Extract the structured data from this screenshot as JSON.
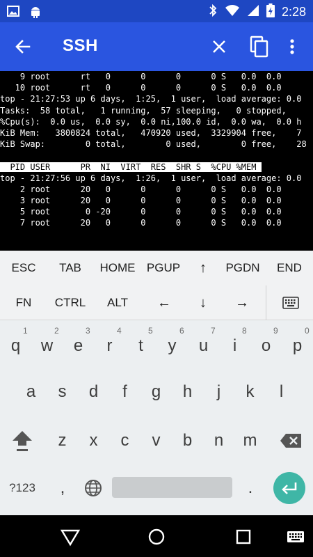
{
  "status_bar": {
    "time": "2:28",
    "icons": [
      "image-icon",
      "android-icon",
      "bluetooth-icon",
      "wifi-icon",
      "signal-icon",
      "battery-charging-icon"
    ]
  },
  "app_bar": {
    "title": "SSH",
    "bg_color": "#2a55e0"
  },
  "terminal": {
    "lines": [
      "    9 root      rt   0      0      0      0 S   0.0  0.0",
      "   10 root      rt   0      0      0      0 S   0.0  0.0",
      "top - 21:27:53 up 6 days,  1:25,  1 user,  load average: 0.0",
      "Tasks:  58 total,   1 running,  57 sleeping,   0 stopped,",
      "%Cpu(s):  0.0 us,  0.0 sy,  0.0 ni,100.0 id,  0.0 wa,  0.0 h",
      "KiB Mem:   3800824 total,   470920 used,  3329904 free,    7",
      "KiB Swap:        0 total,        0 used,        0 free,    28",
      "",
      "  PID USER      PR  NI  VIRT  RES  SHR S  %CPU %MEM ",
      "top - 21:27:56 up 6 days,  1:26,  1 user,  load average: 0.0",
      "    2 root      20   0      0      0      0 S   0.0  0.0",
      "    3 root      20   0      0      0      0 S   0.0  0.0",
      "    5 root       0 -20      0      0      0 S   0.0  0.0",
      "    7 root      20   0      0      0      0 S   0.0  0.0"
    ]
  },
  "extra_keys": {
    "row1": [
      "ESC",
      "TAB",
      "HOME",
      "PGUP",
      "↑",
      "PGDN",
      "END"
    ],
    "row2": [
      "FN",
      "CTRL",
      "ALT",
      "←",
      "↓",
      "→"
    ]
  },
  "keyboard": {
    "row1": [
      "q",
      "w",
      "e",
      "r",
      "t",
      "y",
      "u",
      "i",
      "o",
      "p"
    ],
    "row1_hints": [
      "1",
      "2",
      "3",
      "4",
      "5",
      "6",
      "7",
      "8",
      "9",
      "0"
    ],
    "row2": [
      "a",
      "s",
      "d",
      "f",
      "g",
      "h",
      "j",
      "k",
      "l"
    ],
    "row3": [
      "z",
      "x",
      "c",
      "v",
      "b",
      "n",
      "m"
    ],
    "symbols_key": "?123",
    "comma": ",",
    "period": ".",
    "enter_color": "#3fb6a6"
  }
}
